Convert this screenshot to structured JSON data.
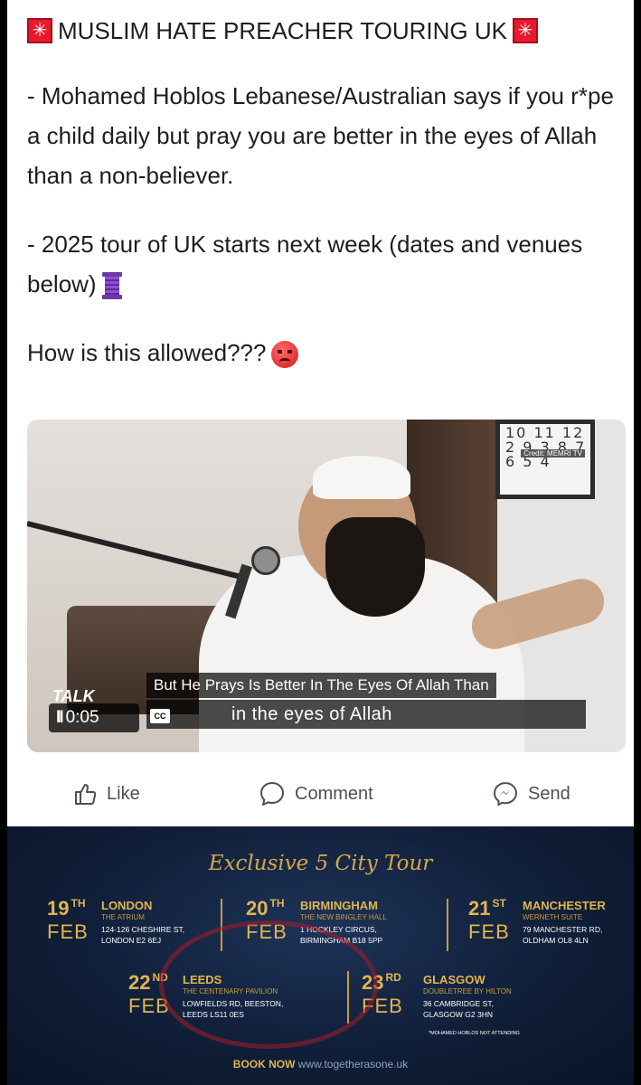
{
  "post": {
    "headline": "MUSLIM HATE PREACHER TOURING UK",
    "para1": "- Mohamed Hoblos Lebanese/Australian says if you r*pe a child daily but pray you are better in the eyes of Allah than a non-believer.",
    "para2": "- 2025 tour of UK starts next week (dates and venues below)",
    "para3": "How is this allowed???"
  },
  "icons": {
    "siren": "police-light-icon",
    "spool": "thread-spool-icon",
    "angry": "angry-face-icon",
    "like": "thumbs-up-icon",
    "comment": "comment-bubble-icon",
    "send": "messenger-icon"
  },
  "video": {
    "subtitle_top": "But He Prays Is Better In The Eyes Of Allah Than",
    "subtitle_bottom": "in the eyes of Allah",
    "time": "0:05",
    "cc": "CC",
    "channel": "TALK",
    "clock_digits": "10 11 12 2 9 3 8 7 6 5 4",
    "credit": "Credit: MEMRI TV"
  },
  "actions": {
    "like": "Like",
    "comment": "Comment",
    "send": "Send"
  },
  "poster": {
    "title": "Exclusive 5 City Tour",
    "cities": [
      {
        "day": "19",
        "suffix": "TH",
        "month": "FEB",
        "city": "LONDON",
        "venue": "THE ATRIUM",
        "addr1": "124-126 CHESHIRE ST,",
        "addr2": "LONDON E2 6EJ"
      },
      {
        "day": "20",
        "suffix": "TH",
        "month": "FEB",
        "city": "BIRMINGHAM",
        "venue": "THE NEW BINGLEY HALL",
        "addr1": "1 HOCKLEY CIRCUS,",
        "addr2": "BIRMINGHAM B18 5PP"
      },
      {
        "day": "21",
        "suffix": "ST",
        "month": "FEB",
        "city": "MANCHESTER",
        "venue": "WERNETH SUITE",
        "addr1": "79 MANCHESTER RD,",
        "addr2": "OLDHAM OL8 4LN"
      },
      {
        "day": "22",
        "suffix": "ND",
        "month": "FEB",
        "city": "LEEDS",
        "venue": "THE CENTENARY PAVILION",
        "addr1": "LOWFIELDS RD, BEESTON,",
        "addr2": "LEEDS LS11 0ES"
      },
      {
        "day": "23",
        "suffix": "RD",
        "month": "FEB",
        "city": "GLASGOW",
        "venue": "DOUBLETREE BY HILTON",
        "addr1": "36 CAMBRIDGE ST,",
        "addr2": "GLASGOW G2 3HN"
      }
    ],
    "note": "*MOHAMED HOBLOS NOT ATTENDING",
    "book": "BOOK NOW",
    "url": "www.togetherasone.uk"
  }
}
